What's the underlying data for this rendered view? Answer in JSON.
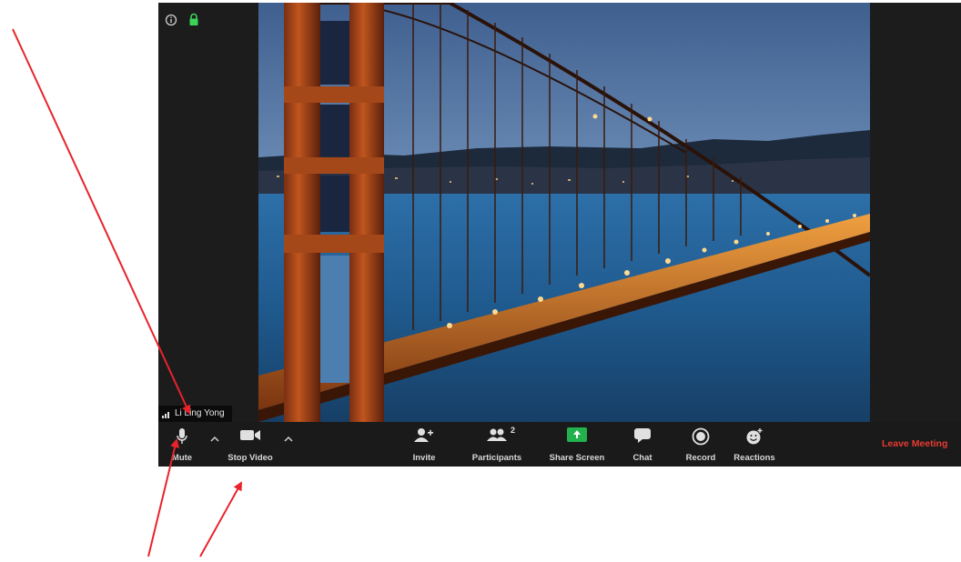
{
  "participant": {
    "name": "Li Ling Yong"
  },
  "toolbar": {
    "mute_label": "Mute",
    "video_label": "Stop Video",
    "invite_label": "Invite",
    "participants_label": "Participants",
    "participants_count": "2",
    "share_label": "Share Screen",
    "chat_label": "Chat",
    "record_label": "Record",
    "reactions_label": "Reactions",
    "leave_label": "Leave Meeting"
  },
  "colors": {
    "toolbar_bg": "#1a1a1a",
    "share_green": "#22b14c",
    "leave_red": "#e63b32",
    "annotation_red": "#e8242a"
  },
  "icons": [
    "info-icon",
    "lock-icon",
    "microphone-icon",
    "video-camera-icon",
    "add-user-icon",
    "participants-icon",
    "share-screen-icon",
    "chat-icon",
    "record-icon",
    "reactions-icon"
  ]
}
